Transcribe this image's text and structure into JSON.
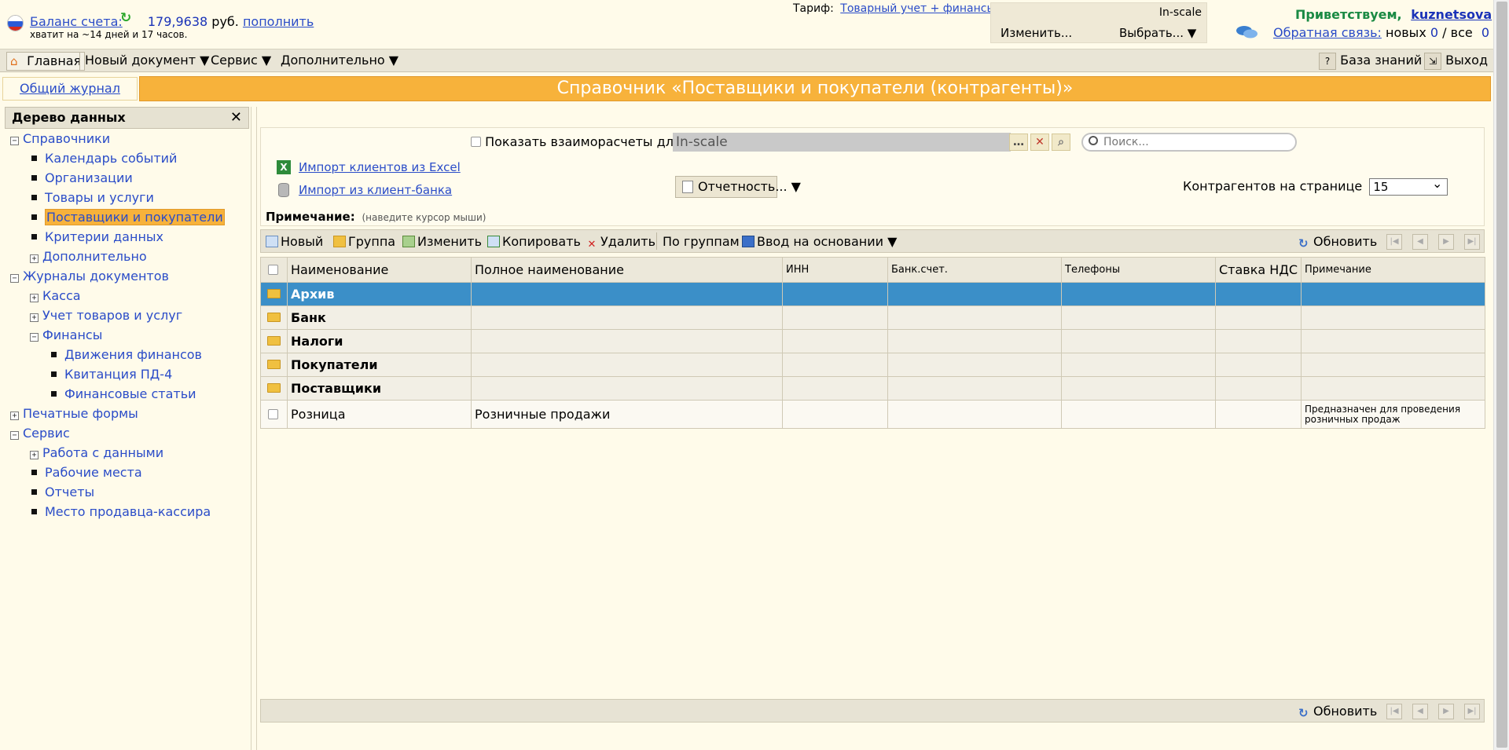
{
  "header": {
    "balance_label": "Баланс счета:",
    "balance_value": "179,9638",
    "balance_currency": "руб.",
    "topup_link": "пополнить",
    "balance_sub": "хватит на ~14 дней и 17 часов.",
    "tariff_label": "Тариф:",
    "tariff_link": "Товарный учет + финансы",
    "org_name": "In-scale",
    "change_button": "Изменить...",
    "select_button": "Выбрать... ▼",
    "greeting": "Приветствуем,",
    "username": "kuznetsova",
    "feedback_link": "Обратная связь:",
    "feedback_new_label": "новых",
    "feedback_new_count": "0",
    "feedback_sep": "/",
    "feedback_all_label": "все",
    "feedback_all_count": "0"
  },
  "menu": {
    "home": "Главная",
    "new_doc": "Новый документ ▼",
    "service": "Сервис ▼",
    "extra": "Дополнительно ▼",
    "knowledge": "База знаний",
    "exit": "Выход"
  },
  "journal_tab": "Общий журнал",
  "page_title": "Справочник «Поставщики и покупатели (контрагенты)»",
  "tree": {
    "title": "Дерево данных",
    "close": "✕",
    "nodes": [
      {
        "label": "Справочники",
        "box": "−"
      },
      {
        "label": "Календарь событий"
      },
      {
        "label": "Организации"
      },
      {
        "label": "Товары и услуги"
      },
      {
        "label": "Поставщики и покупатели"
      },
      {
        "label": "Критерии данных"
      },
      {
        "label": "Дополнительно",
        "box": "+"
      },
      {
        "label": "Журналы документов",
        "box": "−"
      },
      {
        "label": "Касса",
        "box": "+"
      },
      {
        "label": "Учет товаров и услуг",
        "box": "+"
      },
      {
        "label": "Финансы",
        "box": "−"
      },
      {
        "label": "Движения финансов"
      },
      {
        "label": "Квитанция ПД-4"
      },
      {
        "label": "Финансовые статьи"
      },
      {
        "label": "Печатные формы",
        "box": "+"
      },
      {
        "label": "Сервис",
        "box": "−"
      },
      {
        "label": "Работа с данными",
        "box": "+"
      },
      {
        "label": "Рабочие места"
      },
      {
        "label": "Отчеты"
      },
      {
        "label": "Место продавца-кассира"
      }
    ]
  },
  "filters": {
    "show_settlements": "Показать взаиморасчеты для",
    "org_value": "In-scale",
    "search_placeholder": "Поиск...",
    "import_excel": "Импорт клиентов из Excel",
    "import_bank": "Импорт из клиент-банка",
    "reports": "Отчетность... ▼",
    "per_page_label": "Контрагентов на странице",
    "per_page_value": "15",
    "note_label": "Примечание:",
    "note_hint": "(наведите курсор мыши)"
  },
  "toolbar": {
    "new": "Новый",
    "group": "Группа",
    "edit": "Изменить",
    "copy": "Копировать",
    "delete": "Удалить",
    "by_groups": "По группам",
    "based_on": "Ввод на основании ▼",
    "refresh": "Обновить"
  },
  "table": {
    "columns": [
      "Наименование",
      "Полное наименование",
      "ИНН",
      "Банк.счет.",
      "Телефоны",
      "Ставка НДС",
      "Примечание"
    ],
    "rows": [
      {
        "name": "Архив",
        "full": "",
        "note": ""
      },
      {
        "name": "Банк",
        "full": "",
        "note": ""
      },
      {
        "name": "Налоги",
        "full": "",
        "note": ""
      },
      {
        "name": "Покупатели",
        "full": "",
        "note": ""
      },
      {
        "name": "Поставщики",
        "full": "",
        "note": ""
      },
      {
        "name": "Розница",
        "full": "Розничные продажи",
        "note": "Предназначен для проведения розничных продаж"
      }
    ]
  },
  "colors": {
    "accent_orange": "#f7b23b",
    "selected_row": "#3b8fc8",
    "link_blue": "#2a4cc8",
    "greeting_green": "#1a8a44"
  }
}
